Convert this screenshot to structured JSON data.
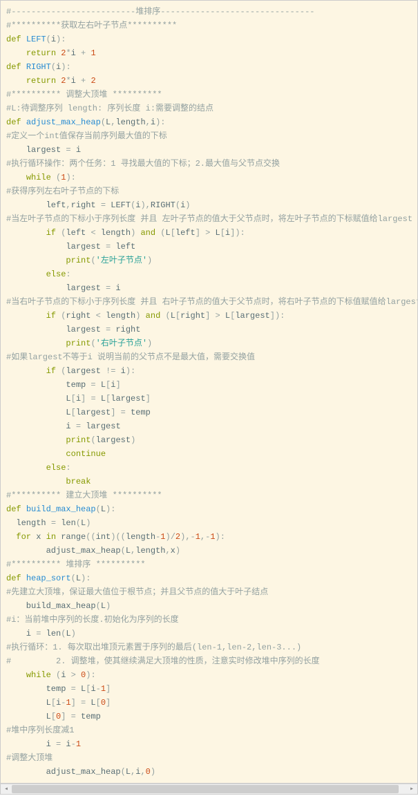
{
  "code_lines": [
    [
      [
        "c",
        "#-------------------------堆排序-------------------------------"
      ]
    ],
    [
      [
        "c",
        "#**********获取左右叶子节点**********"
      ]
    ],
    [
      [
        "kw",
        "def"
      ],
      [
        "id",
        " "
      ],
      [
        "fn",
        "LEFT"
      ],
      [
        "op",
        "("
      ],
      [
        "id",
        "i"
      ],
      [
        "op",
        ")"
      ],
      [
        "op",
        ":"
      ]
    ],
    [
      [
        "id",
        "    "
      ],
      [
        "kw",
        "return"
      ],
      [
        "id",
        " "
      ],
      [
        "nm",
        "2"
      ],
      [
        "op",
        "*"
      ],
      [
        "id",
        "i "
      ],
      [
        "op",
        "+"
      ],
      [
        "id",
        " "
      ],
      [
        "nm",
        "1"
      ]
    ],
    [
      [
        "kw",
        "def"
      ],
      [
        "id",
        " "
      ],
      [
        "fn",
        "RIGHT"
      ],
      [
        "op",
        "("
      ],
      [
        "id",
        "i"
      ],
      [
        "op",
        ")"
      ],
      [
        "op",
        ":"
      ]
    ],
    [
      [
        "id",
        "    "
      ],
      [
        "kw",
        "return"
      ],
      [
        "id",
        " "
      ],
      [
        "nm",
        "2"
      ],
      [
        "op",
        "*"
      ],
      [
        "id",
        "i "
      ],
      [
        "op",
        "+"
      ],
      [
        "id",
        " "
      ],
      [
        "nm",
        "2"
      ]
    ],
    [
      [
        "c",
        "#********** 调整大顶堆 **********"
      ]
    ],
    [
      [
        "c",
        "#L:待调整序列 length: 序列长度 i:需要调整的结点"
      ]
    ],
    [
      [
        "kw",
        "def"
      ],
      [
        "id",
        " "
      ],
      [
        "fn",
        "adjust_max_heap"
      ],
      [
        "op",
        "("
      ],
      [
        "id",
        "L"
      ],
      [
        "op",
        ","
      ],
      [
        "id",
        "length"
      ],
      [
        "op",
        ","
      ],
      [
        "id",
        "i"
      ],
      [
        "op",
        ")"
      ],
      [
        "op",
        ":"
      ]
    ],
    [
      [
        "c",
        "#定义一个int值保存当前序列最大值的下标"
      ]
    ],
    [
      [
        "id",
        "    largest "
      ],
      [
        "op",
        "="
      ],
      [
        "id",
        " i"
      ]
    ],
    [
      [
        "c",
        "#执行循环操作：两个任务：1 寻找最大值的下标；2.最大值与父节点交换"
      ]
    ],
    [
      [
        "id",
        "    "
      ],
      [
        "kw",
        "while"
      ],
      [
        "id",
        " "
      ],
      [
        "op",
        "("
      ],
      [
        "nm",
        "1"
      ],
      [
        "op",
        ")"
      ],
      [
        "op",
        ":"
      ]
    ],
    [
      [
        "c",
        "#获得序列左右叶子节点的下标"
      ]
    ],
    [
      [
        "id",
        "        left"
      ],
      [
        "op",
        ","
      ],
      [
        "id",
        "right "
      ],
      [
        "op",
        "="
      ],
      [
        "id",
        " LEFT"
      ],
      [
        "op",
        "("
      ],
      [
        "id",
        "i"
      ],
      [
        "op",
        ")"
      ],
      [
        "op",
        ","
      ],
      [
        "id",
        "RIGHT"
      ],
      [
        "op",
        "("
      ],
      [
        "id",
        "i"
      ],
      [
        "op",
        ")"
      ]
    ],
    [
      [
        "c",
        "#当左叶子节点的下标小于序列长度 并且 左叶子节点的值大于父节点时，将左叶子节点的下标赋值给largest"
      ]
    ],
    [
      [
        "id",
        "        "
      ],
      [
        "kw",
        "if"
      ],
      [
        "id",
        " "
      ],
      [
        "op",
        "("
      ],
      [
        "id",
        "left "
      ],
      [
        "op",
        "<"
      ],
      [
        "id",
        " length"
      ],
      [
        "op",
        ")"
      ],
      [
        "id",
        " "
      ],
      [
        "kw",
        "and"
      ],
      [
        "id",
        " "
      ],
      [
        "op",
        "("
      ],
      [
        "id",
        "L"
      ],
      [
        "op",
        "["
      ],
      [
        "id",
        "left"
      ],
      [
        "op",
        "]"
      ],
      [
        "id",
        " "
      ],
      [
        "op",
        ">"
      ],
      [
        "id",
        " L"
      ],
      [
        "op",
        "["
      ],
      [
        "id",
        "i"
      ],
      [
        "op",
        "]"
      ],
      [
        "op",
        ")"
      ],
      [
        "op",
        ":"
      ]
    ],
    [
      [
        "id",
        "            largest "
      ],
      [
        "op",
        "="
      ],
      [
        "id",
        " left"
      ]
    ],
    [
      [
        "id",
        "            "
      ],
      [
        "kw",
        "print"
      ],
      [
        "op",
        "("
      ],
      [
        "st",
        "'左叶子节点'"
      ],
      [
        "op",
        ")"
      ]
    ],
    [
      [
        "id",
        "        "
      ],
      [
        "kw",
        "else"
      ],
      [
        "op",
        ":"
      ]
    ],
    [
      [
        "id",
        "            largest "
      ],
      [
        "op",
        "="
      ],
      [
        "id",
        " i"
      ]
    ],
    [
      [
        "c",
        "#当右叶子节点的下标小于序列长度 并且 右叶子节点的值大于父节点时，将右叶子节点的下标值赋值给largest"
      ]
    ],
    [
      [
        "id",
        "        "
      ],
      [
        "kw",
        "if"
      ],
      [
        "id",
        " "
      ],
      [
        "op",
        "("
      ],
      [
        "id",
        "right "
      ],
      [
        "op",
        "<"
      ],
      [
        "id",
        " length"
      ],
      [
        "op",
        ")"
      ],
      [
        "id",
        " "
      ],
      [
        "kw",
        "and"
      ],
      [
        "id",
        " "
      ],
      [
        "op",
        "("
      ],
      [
        "id",
        "L"
      ],
      [
        "op",
        "["
      ],
      [
        "id",
        "right"
      ],
      [
        "op",
        "]"
      ],
      [
        "id",
        " "
      ],
      [
        "op",
        ">"
      ],
      [
        "id",
        " L"
      ],
      [
        "op",
        "["
      ],
      [
        "id",
        "largest"
      ],
      [
        "op",
        "]"
      ],
      [
        "op",
        ")"
      ],
      [
        "op",
        ":"
      ]
    ],
    [
      [
        "id",
        "            largest "
      ],
      [
        "op",
        "="
      ],
      [
        "id",
        " right"
      ]
    ],
    [
      [
        "id",
        "            "
      ],
      [
        "kw",
        "print"
      ],
      [
        "op",
        "("
      ],
      [
        "st",
        "'右叶子节点'"
      ],
      [
        "op",
        ")"
      ]
    ],
    [
      [
        "c",
        "#如果largest不等于i 说明当前的父节点不是最大值，需要交换值"
      ]
    ],
    [
      [
        "id",
        "        "
      ],
      [
        "kw",
        "if"
      ],
      [
        "id",
        " "
      ],
      [
        "op",
        "("
      ],
      [
        "id",
        "largest "
      ],
      [
        "op",
        "!="
      ],
      [
        "id",
        " i"
      ],
      [
        "op",
        ")"
      ],
      [
        "op",
        ":"
      ]
    ],
    [
      [
        "id",
        "            temp "
      ],
      [
        "op",
        "="
      ],
      [
        "id",
        " L"
      ],
      [
        "op",
        "["
      ],
      [
        "id",
        "i"
      ],
      [
        "op",
        "]"
      ]
    ],
    [
      [
        "id",
        "            L"
      ],
      [
        "op",
        "["
      ],
      [
        "id",
        "i"
      ],
      [
        "op",
        "]"
      ],
      [
        "id",
        " "
      ],
      [
        "op",
        "="
      ],
      [
        "id",
        " L"
      ],
      [
        "op",
        "["
      ],
      [
        "id",
        "largest"
      ],
      [
        "op",
        "]"
      ]
    ],
    [
      [
        "id",
        "            L"
      ],
      [
        "op",
        "["
      ],
      [
        "id",
        "largest"
      ],
      [
        "op",
        "]"
      ],
      [
        "id",
        " "
      ],
      [
        "op",
        "="
      ],
      [
        "id",
        " temp"
      ]
    ],
    [
      [
        "id",
        "            i "
      ],
      [
        "op",
        "="
      ],
      [
        "id",
        " largest"
      ]
    ],
    [
      [
        "id",
        "            "
      ],
      [
        "kw",
        "print"
      ],
      [
        "op",
        "("
      ],
      [
        "id",
        "largest"
      ],
      [
        "op",
        ")"
      ]
    ],
    [
      [
        "id",
        "            "
      ],
      [
        "kw",
        "continue"
      ]
    ],
    [
      [
        "id",
        "        "
      ],
      [
        "kw",
        "else"
      ],
      [
        "op",
        ":"
      ]
    ],
    [
      [
        "id",
        "            "
      ],
      [
        "kw",
        "break"
      ]
    ],
    [
      [
        "c",
        "#********** 建立大顶堆 **********"
      ]
    ],
    [
      [
        "kw",
        "def"
      ],
      [
        "id",
        " "
      ],
      [
        "fn",
        "build_max_heap"
      ],
      [
        "op",
        "("
      ],
      [
        "id",
        "L"
      ],
      [
        "op",
        ")"
      ],
      [
        "op",
        ":"
      ]
    ],
    [
      [
        "id",
        "  length "
      ],
      [
        "op",
        "="
      ],
      [
        "id",
        " len"
      ],
      [
        "op",
        "("
      ],
      [
        "id",
        "L"
      ],
      [
        "op",
        ")"
      ]
    ],
    [
      [
        "id",
        "  "
      ],
      [
        "kw",
        "for"
      ],
      [
        "id",
        " x "
      ],
      [
        "kw",
        "in"
      ],
      [
        "id",
        " range"
      ],
      [
        "op",
        "(("
      ],
      [
        "id",
        "int"
      ],
      [
        "op",
        ")(("
      ],
      [
        "id",
        "length"
      ],
      [
        "op",
        "-"
      ],
      [
        "nm",
        "1"
      ],
      [
        "op",
        ")"
      ],
      [
        "op",
        "/"
      ],
      [
        "nm",
        "2"
      ],
      [
        "op",
        ")"
      ],
      [
        "op",
        ","
      ],
      [
        "op",
        "-"
      ],
      [
        "nm",
        "1"
      ],
      [
        "op",
        ","
      ],
      [
        "op",
        "-"
      ],
      [
        "nm",
        "1"
      ],
      [
        "op",
        ")"
      ],
      [
        "op",
        ":"
      ]
    ],
    [
      [
        "id",
        "        adjust_max_heap"
      ],
      [
        "op",
        "("
      ],
      [
        "id",
        "L"
      ],
      [
        "op",
        ","
      ],
      [
        "id",
        "length"
      ],
      [
        "op",
        ","
      ],
      [
        "id",
        "x"
      ],
      [
        "op",
        ")"
      ]
    ],
    [
      [
        "c",
        "#********** 堆排序 **********"
      ]
    ],
    [
      [
        "kw",
        "def"
      ],
      [
        "id",
        " "
      ],
      [
        "fn",
        "heap_sort"
      ],
      [
        "op",
        "("
      ],
      [
        "id",
        "L"
      ],
      [
        "op",
        ")"
      ],
      [
        "op",
        ":"
      ]
    ],
    [
      [
        "c",
        "#先建立大顶堆，保证最大值位于根节点；并且父节点的值大于叶子结点"
      ]
    ],
    [
      [
        "id",
        "    build_max_heap"
      ],
      [
        "op",
        "("
      ],
      [
        "id",
        "L"
      ],
      [
        "op",
        ")"
      ]
    ],
    [
      [
        "c",
        "#i：当前堆中序列的长度.初始化为序列的长度"
      ]
    ],
    [
      [
        "id",
        "    i "
      ],
      [
        "op",
        "="
      ],
      [
        "id",
        " len"
      ],
      [
        "op",
        "("
      ],
      [
        "id",
        "L"
      ],
      [
        "op",
        ")"
      ]
    ],
    [
      [
        "c",
        "#执行循环：1. 每次取出堆顶元素置于序列的最后(len-1,len-2,len-3...)"
      ]
    ],
    [
      [
        "c",
        "#         2. 调整堆，使其继续满足大顶堆的性质，注意实时修改堆中序列的长度"
      ]
    ],
    [
      [
        "id",
        "    "
      ],
      [
        "kw",
        "while"
      ],
      [
        "id",
        " "
      ],
      [
        "op",
        "("
      ],
      [
        "id",
        "i "
      ],
      [
        "op",
        ">"
      ],
      [
        "id",
        " "
      ],
      [
        "nm",
        "0"
      ],
      [
        "op",
        ")"
      ],
      [
        "op",
        ":"
      ]
    ],
    [
      [
        "id",
        "        temp "
      ],
      [
        "op",
        "="
      ],
      [
        "id",
        " L"
      ],
      [
        "op",
        "["
      ],
      [
        "id",
        "i"
      ],
      [
        "op",
        "-"
      ],
      [
        "nm",
        "1"
      ],
      [
        "op",
        "]"
      ]
    ],
    [
      [
        "id",
        "        L"
      ],
      [
        "op",
        "["
      ],
      [
        "id",
        "i"
      ],
      [
        "op",
        "-"
      ],
      [
        "nm",
        "1"
      ],
      [
        "op",
        "]"
      ],
      [
        "id",
        " "
      ],
      [
        "op",
        "="
      ],
      [
        "id",
        " L"
      ],
      [
        "op",
        "["
      ],
      [
        "nm",
        "0"
      ],
      [
        "op",
        "]"
      ]
    ],
    [
      [
        "id",
        "        L"
      ],
      [
        "op",
        "["
      ],
      [
        "nm",
        "0"
      ],
      [
        "op",
        "]"
      ],
      [
        "id",
        " "
      ],
      [
        "op",
        "="
      ],
      [
        "id",
        " temp"
      ]
    ],
    [
      [
        "c",
        "#堆中序列长度减1"
      ]
    ],
    [
      [
        "id",
        "        i "
      ],
      [
        "op",
        "="
      ],
      [
        "id",
        " i"
      ],
      [
        "op",
        "-"
      ],
      [
        "nm",
        "1"
      ]
    ],
    [
      [
        "c",
        "#调整大顶堆"
      ]
    ],
    [
      [
        "id",
        "        adjust_max_heap"
      ],
      [
        "op",
        "("
      ],
      [
        "id",
        "L"
      ],
      [
        "op",
        ","
      ],
      [
        "id",
        "i"
      ],
      [
        "op",
        ","
      ],
      [
        "nm",
        "0"
      ],
      [
        "op",
        ")"
      ]
    ]
  ]
}
